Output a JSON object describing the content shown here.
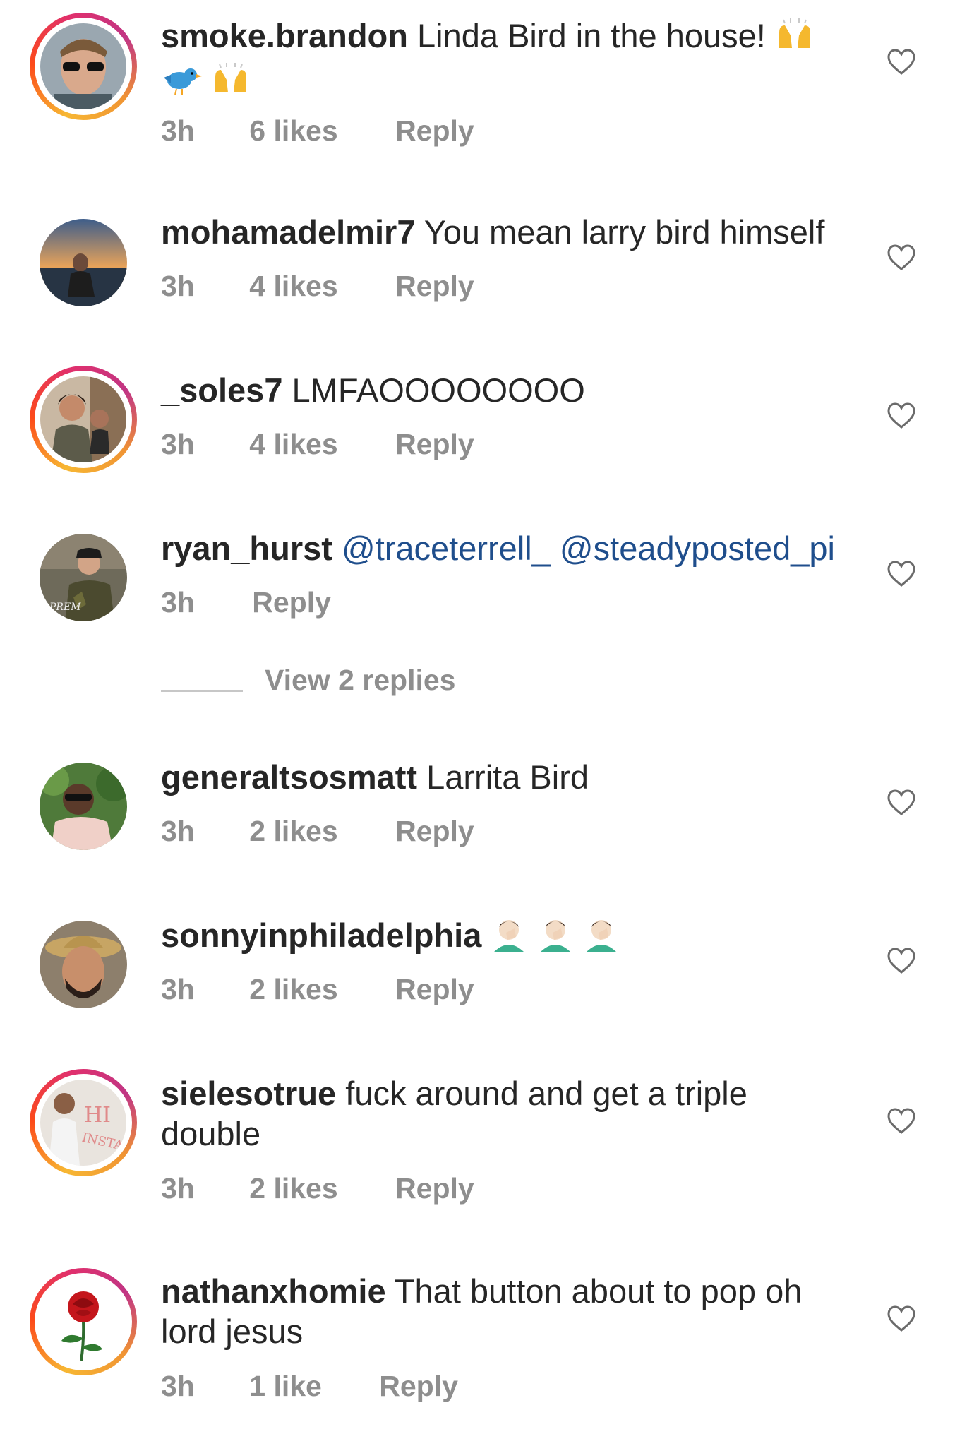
{
  "comments": [
    {
      "username": "smoke.brandon",
      "text": "Linda Bird in the house!",
      "time": "3h",
      "likes": "6 likes",
      "reply": "Reply"
    },
    {
      "username": "mohamadelmir7",
      "text": "You mean larry bird himself",
      "time": "3h",
      "likes": "4 likes",
      "reply": "Reply"
    },
    {
      "username": "_soles7",
      "text": "LMFAOOOOOOOO",
      "time": "3h",
      "likes": "4 likes",
      "reply": "Reply"
    },
    {
      "username": "ryan_hurst",
      "mention1": "@traceterrell_",
      "mention2": "@steadyposted_pi",
      "time": "3h",
      "reply": "Reply"
    },
    {
      "username": "generaltsosmatt",
      "text": "Larrita Bird",
      "time": "3h",
      "likes": "2 likes",
      "reply": "Reply"
    },
    {
      "username": "sonnyinphiladelphia",
      "time": "3h",
      "likes": "2 likes",
      "reply": "Reply"
    },
    {
      "username": "sielesotrue",
      "text": "fuck around and get a triple double",
      "time": "3h",
      "likes": "2 likes",
      "reply": "Reply"
    },
    {
      "username": "nathanxhomie",
      "text": "That button about to pop oh lord jesus",
      "time": "3h",
      "likes": "1 like",
      "reply": "Reply"
    }
  ],
  "view_replies": "View 2 replies",
  "icons": {
    "like": "heart-outline-icon",
    "raising_hands": "raising-hands-emoji",
    "bird": "bird-emoji",
    "facepalm": "man-facepalming-emoji"
  },
  "colors": {
    "mention": "#1f4e8c",
    "meta": "#8e8e8e",
    "text": "#262626"
  }
}
